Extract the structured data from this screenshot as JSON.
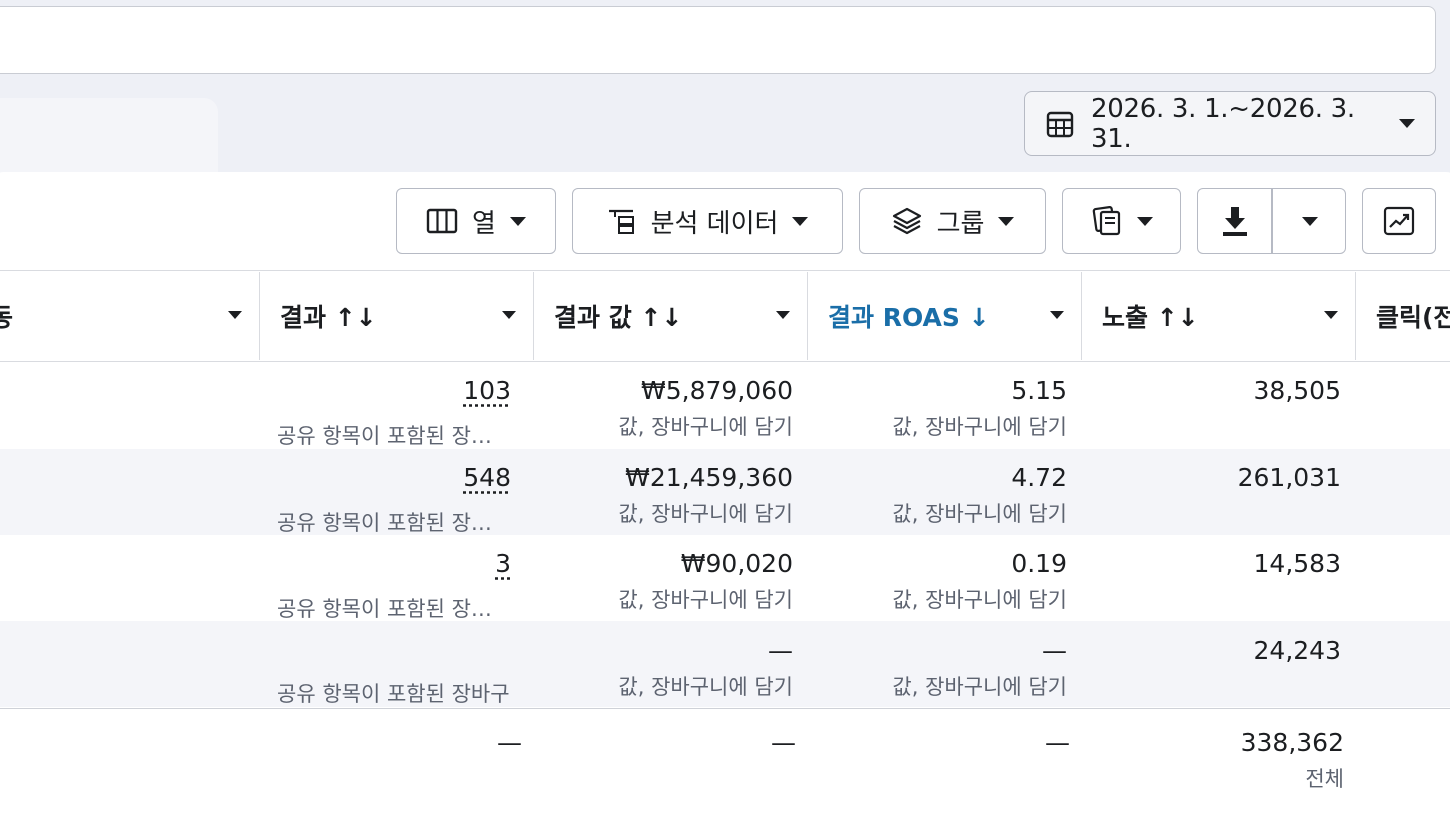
{
  "date_range": {
    "label": "2026. 3. 1.~2026. 3. 31."
  },
  "toolbar": {
    "columns_label": "열",
    "breakdown_label": "분석 데이터",
    "group_label": "그룹"
  },
  "table": {
    "headers": {
      "col0": "동",
      "results": "결과 ↑↓",
      "result_value": "결과 값 ↑↓",
      "result_roas": "결과 ROAS ↓",
      "impressions": "노출 ↑↓",
      "clicks": "클릭(전"
    },
    "rows": [
      {
        "results": "103",
        "results_sub": "공유 항목이 포함된 장…",
        "value": "₩5,879,060",
        "value_sub": "값, 장바구니에 담기",
        "roas": "5.15",
        "roas_sub": "값, 장바구니에 담기",
        "impressions": "38,505"
      },
      {
        "results": "548",
        "results_sub": "공유 항목이 포함된 장…",
        "value": "₩21,459,360",
        "value_sub": "값, 장바구니에 담기",
        "roas": "4.72",
        "roas_sub": "값, 장바구니에 담기",
        "impressions": "261,031"
      },
      {
        "results": "3",
        "results_sub": "공유 항목이 포함된 장…",
        "value": "₩90,020",
        "value_sub": "값, 장바구니에 담기",
        "roas": "0.19",
        "roas_sub": "값, 장바구니에 담기",
        "impressions": "14,583"
      },
      {
        "results": "",
        "results_sub": "공유 항목이 포함된 장바구",
        "value": "—",
        "value_sub": "값, 장바구니에 담기",
        "roas": "—",
        "roas_sub": "값, 장바구니에 담기",
        "impressions": "24,243"
      }
    ],
    "totals": {
      "results": "—",
      "value": "—",
      "roas": "—",
      "impressions": "338,362",
      "impressions_sub": "전체"
    }
  },
  "colors": {
    "accent": "#1a6ea8",
    "border": "#b6bac4",
    "row_shade": "#f4f5f9"
  },
  "icons": [
    "calendar-icon",
    "columns-icon",
    "breakdown-icon",
    "layers-icon",
    "reports-icon",
    "download-icon",
    "chart-trend-icon"
  ]
}
